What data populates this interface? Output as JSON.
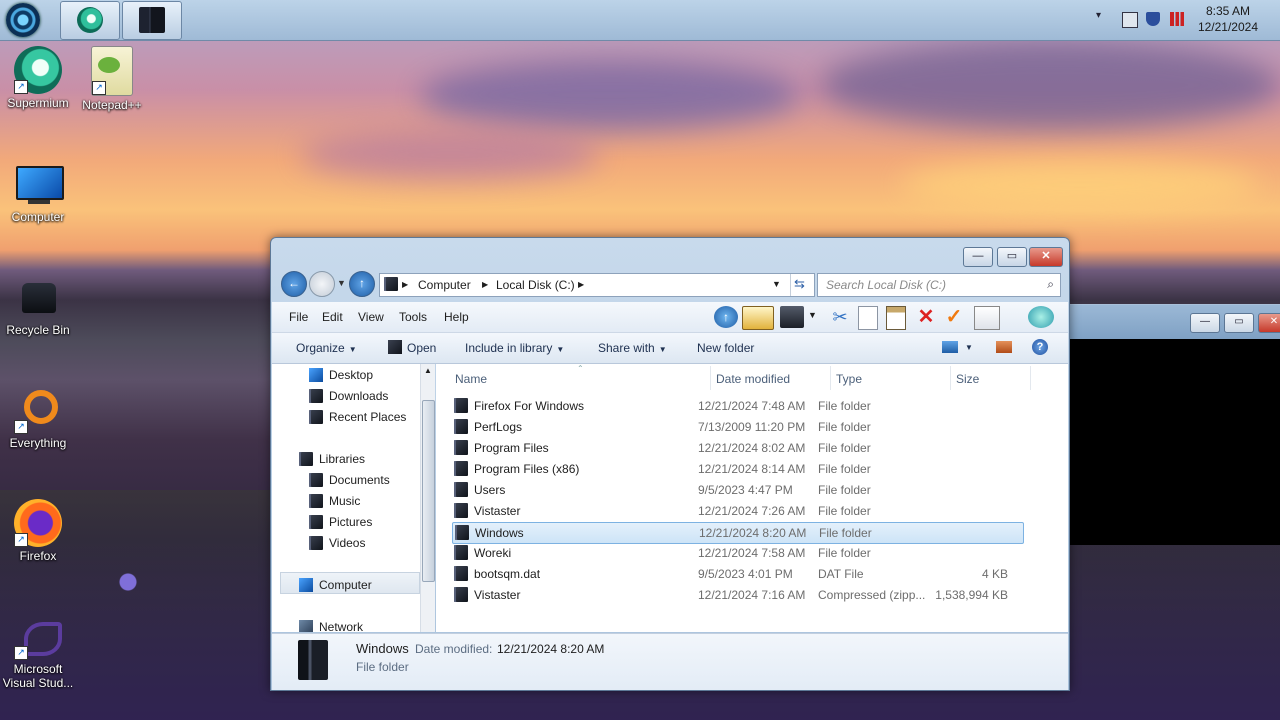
{
  "taskbar": {
    "pinned": [
      {
        "name": "supermium-icon"
      },
      {
        "name": "explorer-icon"
      }
    ],
    "clock": {
      "time": "8:35 AM",
      "date": "12/21/2024"
    }
  },
  "desktop": {
    "icons": [
      {
        "label": "Supermium",
        "icon": "supermium-icon"
      },
      {
        "label": "Notepad++",
        "icon": "notepad-plus-plus-icon"
      },
      {
        "label": "Computer",
        "icon": "computer-monitor-icon"
      },
      {
        "label": "Recycle Bin",
        "icon": "recycle-bin-icon"
      },
      {
        "label": "Everything",
        "icon": "everything-search-icon"
      },
      {
        "label": "Firefox",
        "icon": "firefox-icon"
      },
      {
        "label": "Microsoft Visual Stud...",
        "icon": "visual-studio-icon"
      }
    ]
  },
  "explorer": {
    "address": {
      "root": "Computer",
      "drive": "Local Disk (C:)"
    },
    "search_placeholder": "Search Local Disk (C:)",
    "menu": [
      "File",
      "Edit",
      "View",
      "Tools",
      "Help"
    ],
    "commands": {
      "organize": "Organize",
      "open": "Open",
      "include": "Include in library",
      "share": "Share with",
      "new_folder": "New folder"
    },
    "nav": {
      "desktop": "Desktop",
      "downloads": "Downloads",
      "recent": "Recent Places",
      "libraries": "Libraries",
      "documents": "Documents",
      "music": "Music",
      "pictures": "Pictures",
      "videos": "Videos",
      "computer": "Computer",
      "network": "Network"
    },
    "columns": {
      "name": "Name",
      "date": "Date modified",
      "type": "Type",
      "size": "Size"
    },
    "files": [
      {
        "name": "Firefox For Windows",
        "date": "12/21/2024 7:48 AM",
        "type": "File folder",
        "size": ""
      },
      {
        "name": "PerfLogs",
        "date": "7/13/2009 11:20 PM",
        "type": "File folder",
        "size": ""
      },
      {
        "name": "Program Files",
        "date": "12/21/2024 8:02 AM",
        "type": "File folder",
        "size": ""
      },
      {
        "name": "Program Files (x86)",
        "date": "12/21/2024 8:14 AM",
        "type": "File folder",
        "size": ""
      },
      {
        "name": "Users",
        "date": "9/5/2023 4:47 PM",
        "type": "File folder",
        "size": ""
      },
      {
        "name": "Vistaster",
        "date": "12/21/2024 7:26 AM",
        "type": "File folder",
        "size": ""
      },
      {
        "name": "Windows",
        "date": "12/21/2024 8:20 AM",
        "type": "File folder",
        "size": ""
      },
      {
        "name": "Woreki",
        "date": "12/21/2024 7:58 AM",
        "type": "File folder",
        "size": ""
      },
      {
        "name": "bootsqm.dat",
        "date": "9/5/2023 4:01 PM",
        "type": "DAT File",
        "size": "4 KB"
      },
      {
        "name": "Vistaster",
        "date": "12/21/2024 7:16 AM",
        "type": "Compressed (zipp...",
        "size": "1,538,994 KB"
      }
    ],
    "selected_index": 6,
    "details": {
      "name": "Windows",
      "modified_label": "Date modified:",
      "modified": "12/21/2024 8:20 AM",
      "type": "File folder"
    }
  }
}
